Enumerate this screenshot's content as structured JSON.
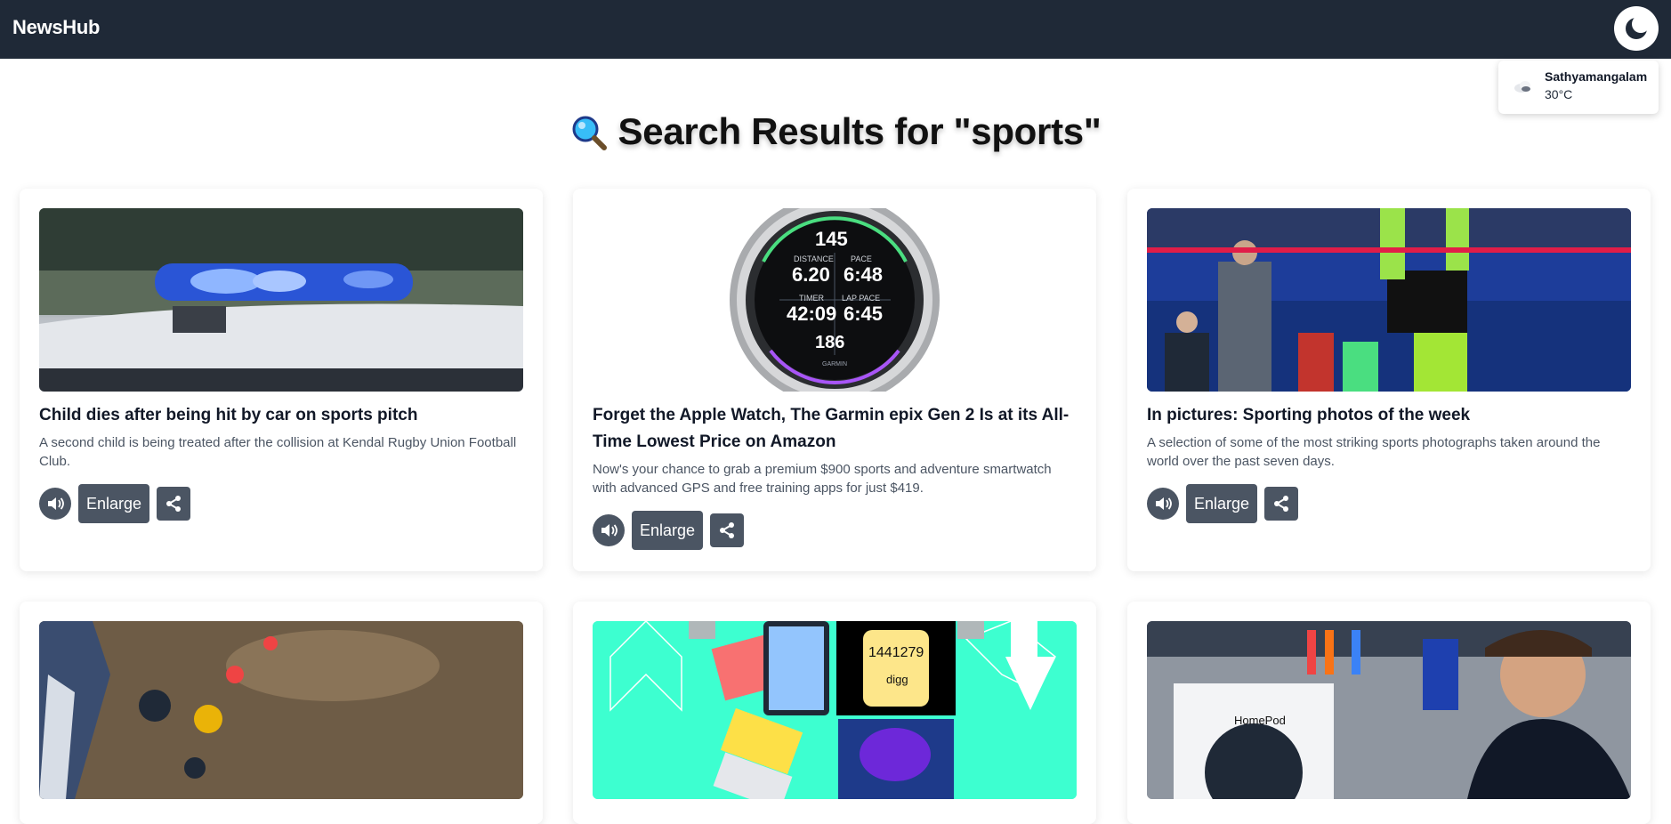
{
  "app": {
    "brand": "NewsHub"
  },
  "weather": {
    "city": "Sathyamangalam",
    "temp": "30°C"
  },
  "page": {
    "heading": "Search Results for \"sports\""
  },
  "actions": {
    "enlarge_label": "Enlarge"
  },
  "articles": [
    {
      "title": "Child dies after being hit by car on sports pitch",
      "description": "A second child is being treated after the collision at Kendal Rugby Union Football Club."
    },
    {
      "title": "Forget the Apple Watch, The Garmin epix Gen 2 Is at its All-Time Lowest Price on Amazon",
      "description": "Now's your chance to grab a premium $900 sports and adventure smartwatch with advanced GPS and free training apps for just $419.",
      "watch": {
        "heart": "145",
        "distance_label": "DISTANCE",
        "distance": "6.20",
        "pace_label": "PACE",
        "pace": "6:48",
        "timer_label": "TIMER",
        "timer": "42:09",
        "lap_label": "LAP PACE",
        "lap": "6:45",
        "cadence": "186",
        "brand": "GARMIN"
      }
    },
    {
      "title": "In pictures: Sporting photos of the week",
      "description": "A selection of some of the most striking sports photographs taken around the world over the past seven days."
    },
    {
      "title": "",
      "description": ""
    },
    {
      "title": "",
      "description": "",
      "image_text": {
        "count": "1441279",
        "logo": "digg"
      }
    },
    {
      "title": "",
      "description": "",
      "image_text": {
        "product": "HomePod"
      }
    }
  ],
  "colors": {
    "topbar": "#1f2937",
    "button": "#4b5563",
    "teal": "#3dffd0"
  }
}
